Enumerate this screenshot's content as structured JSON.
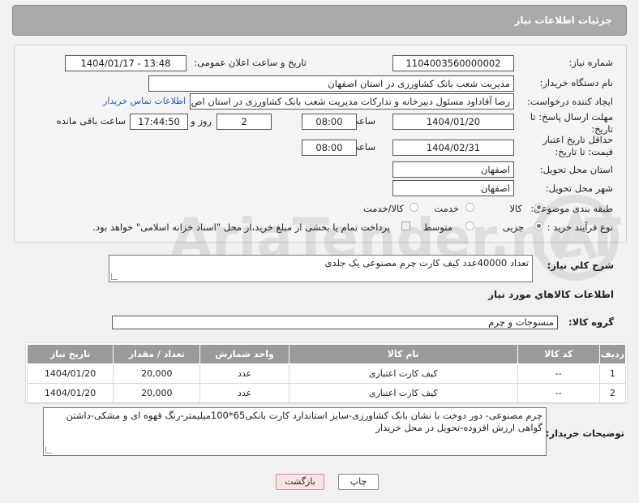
{
  "header": {
    "title": "جزئیات اطلاعات نیاز"
  },
  "form": {
    "need_number_label": "شماره نیاز:",
    "need_number": "1104003560000002",
    "announce_label": "تاریخ و ساعت اعلان عمومی:",
    "announce_value": "1404/01/17 - 13:48",
    "buyer_org_label": "نام دستگاه خریدار:",
    "buyer_org": "مدیریت شعب بانک کشاورزی در استان اصفهان",
    "creator_label": "ایجاد کننده درخواست:",
    "creator": "رضا آقاداود مسئول دبیرخانه و تدارکات مدیریت شعب بانک کشاورزی در استان اص",
    "contact_link": "اطلاعات تماس خریدار",
    "deadline_label": "مهلت ارسال پاسخ: تا تاریخ:",
    "deadline_date": "1404/01/20",
    "time_label": "ساعت",
    "deadline_time": "08:00",
    "days_value": "2",
    "days_label": "روز و",
    "remaining_time": "17:44:50",
    "remaining_label": "ساعت باقی مانده",
    "validity_label": "حداقل تاریخ اعتبار قیمت: تا تاریخ:",
    "validity_date": "1404/02/31",
    "validity_time": "08:00",
    "province_label": "استان محل تحویل:",
    "province": "اصفهان",
    "city_label": "شهر محل تحویل:",
    "city": "اصفهان",
    "category_label": "طبقه بندی موضوعی:",
    "category_options": [
      "کالا",
      "خدمت",
      "کالا/خدمت"
    ],
    "process_label": "نوع فرآیند خرید :",
    "process_options": [
      "جزیی",
      "متوسط"
    ],
    "payment_note": "پرداخت تمام یا بخشی از مبلغ خرید،از محل \"اسناد خزانه اسلامی\" خواهد بود."
  },
  "summary": {
    "label": "شرح کلي نياز:",
    "text": "تعداد 40000عدد کیف کارت چرم مصنوعی یک جلدی"
  },
  "goods": {
    "section_title": "اطلاعات کالاهاي مورد نياز",
    "group_label": "گروه کالا:",
    "group_value": "منسوجات و چرم",
    "columns": [
      "ردیف",
      "کد کالا",
      "نام کالا",
      "واحد شمارش",
      "تعداد / مقدار",
      "تاریخ نیاز"
    ],
    "rows": [
      {
        "idx": "1",
        "code": "--",
        "name": "کیف کارت اعتباری",
        "unit": "عدد",
        "qty": "20,000",
        "date": "1404/01/20"
      },
      {
        "idx": "2",
        "code": "--",
        "name": "کیف کارت اعتباری",
        "unit": "عدد",
        "qty": "20,000",
        "date": "1404/01/20"
      }
    ]
  },
  "buyer_notes": {
    "label": "توضیحات خریدار:",
    "text": "چرم مصنوعی- دور دوخت با نشان بانک کشاورزی-سایز استاندارد کارت بانکی65*100میلیمتر-رنگ قهوه ای و مشکی-داشتن گواهی ارزش افزوده-تحویل در محل خریدار"
  },
  "buttons": {
    "print": "چاپ",
    "back": "بازگشت"
  },
  "watermark": {
    "text": "AriaTender.neT"
  }
}
